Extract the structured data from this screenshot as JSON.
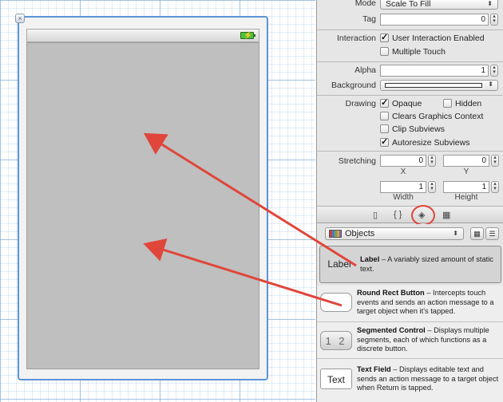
{
  "canvas": {
    "status_bar": {
      "battery_icon": "battery-charging-icon"
    }
  },
  "inspector": {
    "mode": {
      "label": "Mode",
      "value": "Scale To Fill"
    },
    "tag": {
      "label": "Tag",
      "value": "0"
    },
    "interaction": {
      "label": "Interaction",
      "options": [
        {
          "label": "User Interaction Enabled",
          "checked": true
        },
        {
          "label": "Multiple Touch",
          "checked": false
        }
      ]
    },
    "alpha": {
      "label": "Alpha",
      "value": "1"
    },
    "background": {
      "label": "Background"
    },
    "drawing": {
      "label": "Drawing",
      "options": [
        {
          "label": "Opaque",
          "checked": true
        },
        {
          "label": "Hidden",
          "checked": false
        },
        {
          "label": "Clears Graphics Context",
          "checked": false
        },
        {
          "label": "Clip Subviews",
          "checked": false
        },
        {
          "label": "Autoresize Subviews",
          "checked": true
        }
      ]
    },
    "stretching": {
      "label": "Stretching",
      "x": {
        "value": "0",
        "label": "X"
      },
      "y": {
        "value": "0",
        "label": "Y"
      },
      "width": {
        "value": "1",
        "label": "Width"
      },
      "height": {
        "value": "1",
        "label": "Height"
      }
    },
    "tabs": [
      {
        "name": "file-template-icon",
        "glyph": "▯"
      },
      {
        "name": "code-snippet-icon",
        "glyph": "{ }"
      },
      {
        "name": "object-library-icon",
        "glyph": "◈"
      },
      {
        "name": "media-library-icon",
        "glyph": "▦"
      }
    ]
  },
  "library": {
    "selector": {
      "value": "Objects"
    },
    "objects": [
      {
        "thumb": "Label",
        "title": "Label",
        "desc": " – A variably sized amount of static text."
      },
      {
        "thumb": "",
        "title": "Round Rect Button",
        "desc": " – Intercepts touch events and sends an action message to a target object when it's tapped."
      },
      {
        "thumb": "1 2",
        "title": "Segmented Control",
        "desc": " – Displays multiple segments, each of which functions as a discrete button."
      },
      {
        "thumb": "Text",
        "title": "Text Field",
        "desc": " – Displays editable text and sends an action message to a target object when Return is tapped."
      }
    ]
  },
  "colors": {
    "annotation": "#e0463a",
    "selection": "#5b93d8"
  }
}
